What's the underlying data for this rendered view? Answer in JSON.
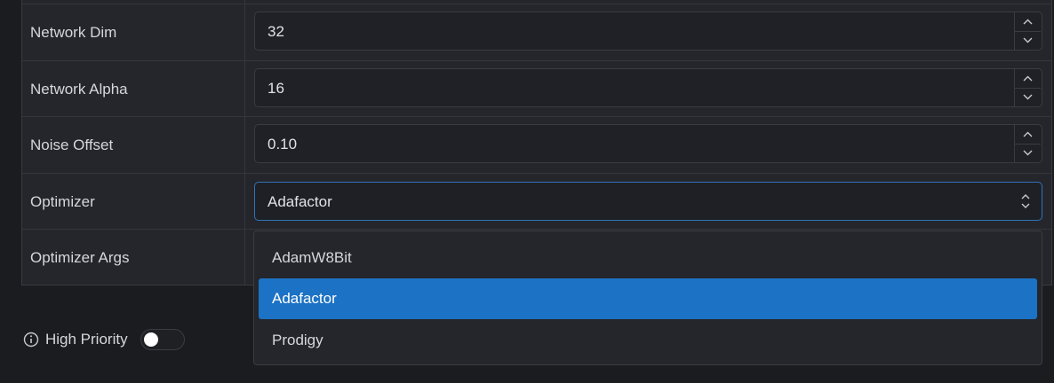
{
  "form": {
    "rows": [
      {
        "label": "Network Dim",
        "value": "32"
      },
      {
        "label": "Network Alpha",
        "value": "16"
      },
      {
        "label": "Noise Offset",
        "value": "0.10"
      },
      {
        "label": "Optimizer",
        "value": "Adafactor"
      },
      {
        "label": "Optimizer Args",
        "value": ""
      }
    ]
  },
  "optimizer_dropdown": {
    "options": [
      "AdamW8Bit",
      "Adafactor",
      "Prodigy"
    ],
    "selected": "Adafactor"
  },
  "high_priority": {
    "label": "High Priority",
    "enabled": false
  },
  "colors": {
    "accent": "#1c72c4",
    "focus_border": "#2f74b8",
    "panel_bg": "#25262b",
    "page_bg": "#1b1c1f"
  },
  "icons": {
    "stepper_up": "chevron-up-icon",
    "stepper_down": "chevron-down-icon",
    "select": "select-updown-icon",
    "info": "info-icon"
  }
}
